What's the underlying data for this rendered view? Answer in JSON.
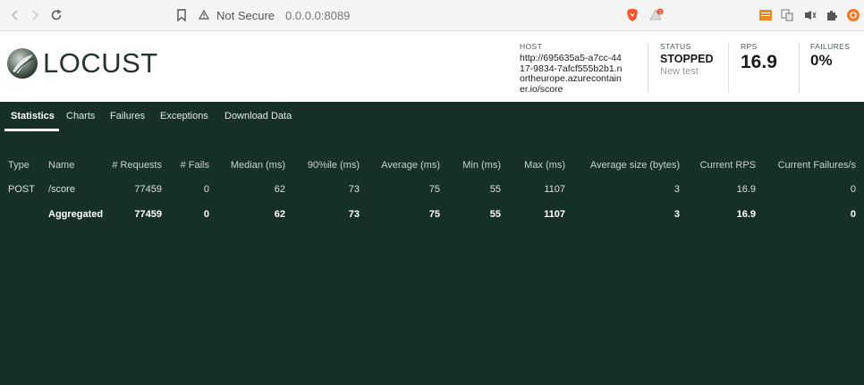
{
  "browser": {
    "not_secure": "Not Secure",
    "url": "0.0.0.0:8089",
    "brave_badge": "1"
  },
  "app": {
    "logo_text": "LOCUST"
  },
  "header": {
    "host_label": "HOST",
    "host_value": "http://695635a5-a7cc-4417-9834-7afcf555b2b1.northeurope.azurecontainer.io/score",
    "status_label": "STATUS",
    "status_value": "STOPPED",
    "status_sub": "New test",
    "rps_label": "RPS",
    "rps_value": "16.9",
    "failures_label": "FAILURES",
    "failures_value": "0%"
  },
  "tabs": [
    {
      "label": "Statistics"
    },
    {
      "label": "Charts"
    },
    {
      "label": "Failures"
    },
    {
      "label": "Exceptions"
    },
    {
      "label": "Download Data"
    }
  ],
  "table": {
    "headers": [
      "Type",
      "Name",
      "# Requests",
      "# Fails",
      "Median (ms)",
      "90%ile (ms)",
      "Average (ms)",
      "Min (ms)",
      "Max (ms)",
      "Average size (bytes)",
      "Current RPS",
      "Current Failures/s"
    ],
    "rows": [
      [
        "POST",
        "/score",
        "77459",
        "0",
        "62",
        "73",
        "75",
        "55",
        "1107",
        "3",
        "16.9",
        "0"
      ]
    ],
    "aggregated": [
      "",
      "Aggregated",
      "77459",
      "0",
      "62",
      "73",
      "75",
      "55",
      "1107",
      "3",
      "16.9",
      "0"
    ]
  },
  "colors": {
    "background": "#173027",
    "header_bg": "#ffffff",
    "brave_orange": "#fb542b"
  }
}
